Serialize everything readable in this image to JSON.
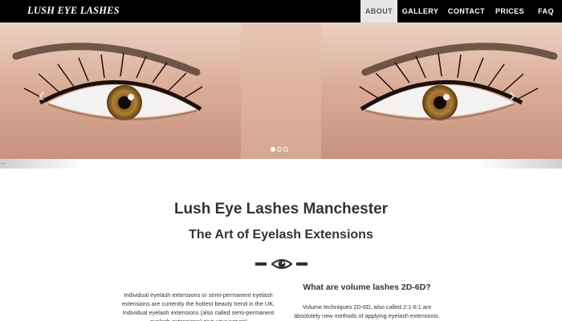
{
  "brand": "LUSH EYE LASHES",
  "nav": [
    {
      "label": "ABOUT",
      "active": true
    },
    {
      "label": "GALLERY",
      "active": false
    },
    {
      "label": "CONTACT",
      "active": false
    },
    {
      "label": "PRICES",
      "active": false
    },
    {
      "label": "FAQ",
      "active": false
    }
  ],
  "hero": {
    "prev_icon": "‹",
    "next_icon": "›",
    "mark": "...",
    "slides": 3,
    "active_slide": 1
  },
  "strip_text": "...",
  "title": "Lush Eye Lashes Manchester",
  "subtitle": "The Art of Eyelash Extensions",
  "left_text": "Individual eyelash extensions or semi-permanent eyelash extensions are currently the hottest beauty trend in the UK. Individual eyelash extensions (also called semi-permanent eyelash extensions) give your natural",
  "right_heading": "What are volume lashes 2D-6D?",
  "right_text": "Volume techniques 2D-6D, also called 2:1-6:1 are absolutely new methods of applying eyelash extensions.",
  "colors": {
    "nav_bg": "#000000",
    "active_nav_bg": "#e7e7e7",
    "text": "#333333"
  }
}
